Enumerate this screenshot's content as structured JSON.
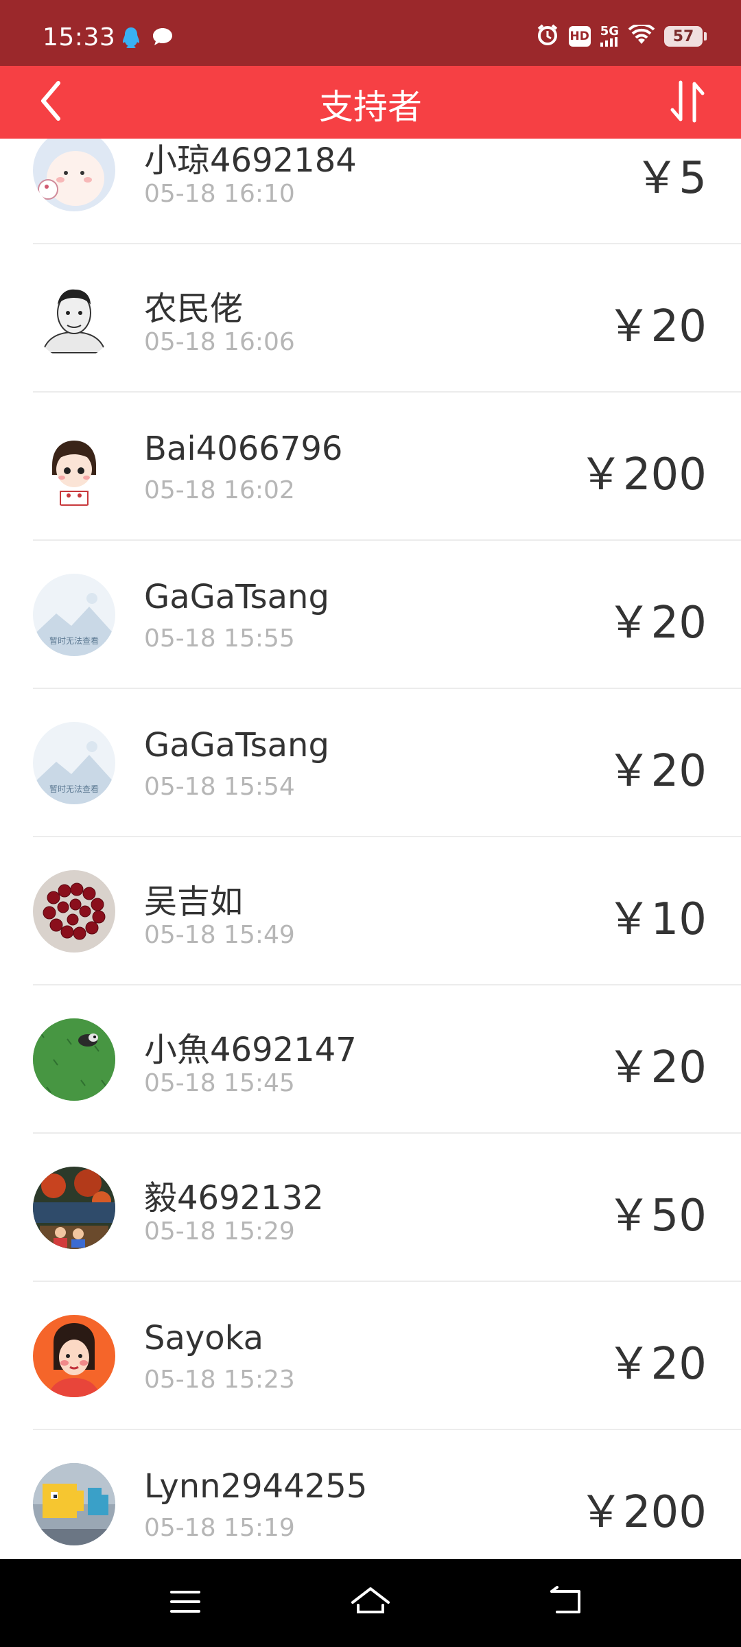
{
  "status_bar": {
    "time": "15:33",
    "network": "5G",
    "hd": "HD",
    "battery": "57"
  },
  "header": {
    "title": "支持者"
  },
  "supporters": [
    {
      "name": "小琼4692184",
      "time": "05-18 16:10",
      "amount": "￥5"
    },
    {
      "name": "农民佬",
      "time": "05-18 16:06",
      "amount": "￥20"
    },
    {
      "name": "Bai4066796",
      "time": "05-18 16:02",
      "amount": "￥200"
    },
    {
      "name": "GaGaTsang",
      "time": "05-18 15:55",
      "amount": "￥20"
    },
    {
      "name": "GaGaTsang",
      "time": "05-18 15:54",
      "amount": "￥20"
    },
    {
      "name": "吴吉如",
      "time": "05-18 15:49",
      "amount": "￥10"
    },
    {
      "name": "小魚4692147",
      "time": "05-18 15:45",
      "amount": "￥20"
    },
    {
      "name": "毅4692132",
      "time": "05-18 15:29",
      "amount": "￥50"
    },
    {
      "name": "Sayoka",
      "time": "05-18 15:23",
      "amount": "￥20"
    },
    {
      "name": "Lynn2944255",
      "time": "05-18 15:19",
      "amount": "￥200"
    }
  ],
  "placeholder_avatar_text": "暂时无法查看",
  "colors": {
    "status_bar": "#9b282b",
    "header": "#f64044",
    "nav_bar": "#000000"
  }
}
